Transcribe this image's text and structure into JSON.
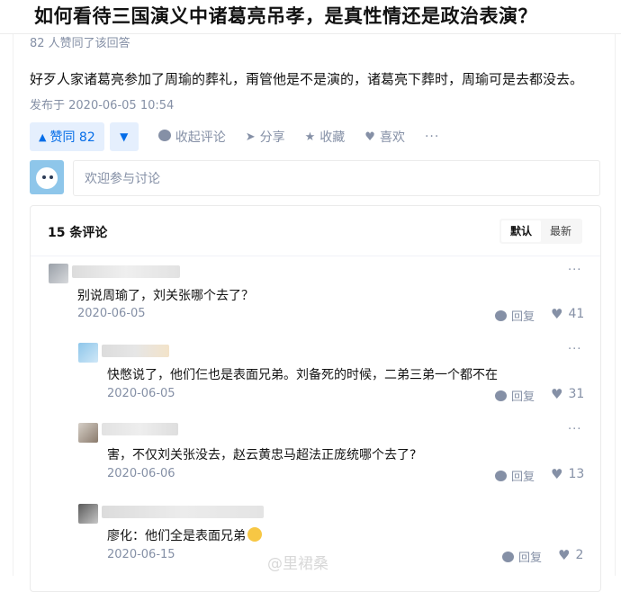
{
  "question": {
    "title": "如何看待三国演义中诸葛亮吊孝，是真性情还是政治表演？"
  },
  "answer": {
    "upvote_meta": "82 人赞同了该回答",
    "content": "好歹人家诸葛亮参加了周瑜的葬礼，甭管他是不是演的，诸葛亮下葬时，周瑜可是去都没去。",
    "published": "发布于 2020-06-05 10:54"
  },
  "actions": {
    "vote_up_label": "赞同 82",
    "vote_up_icon": "▲",
    "vote_down_icon": "▼",
    "collapse_comments": "收起评论",
    "share": "分享",
    "favorite": "收藏",
    "like": "喜欢",
    "more": "···",
    "icons": {
      "comment": "comment-icon",
      "share": "share-icon",
      "favorite": "star-icon",
      "like": "heart-icon"
    }
  },
  "comment_input": {
    "placeholder": "欢迎参与讨论"
  },
  "comments_panel": {
    "count_label": "15 条评论",
    "sort_options": [
      "默认",
      "最新"
    ],
    "active_sort": "默认",
    "comments": [
      {
        "text": "别说周瑜了，刘关张哪个去了？",
        "date": "2020-06-05",
        "reply": "回复",
        "likes": "41",
        "more": "···"
      },
      {
        "text": "快憋说了，他们仨也是表面兄弟。刘备死的时候，二弟三弟一个都不在",
        "date": "2020-06-05",
        "reply": "回复",
        "likes": "31",
        "more": "···"
      },
      {
        "text": "害，不仅刘关张没去，赵云黄忠马超法正庞统哪个去了?",
        "date": "2020-06-06",
        "reply": "回复",
        "likes": "13",
        "more": "···"
      },
      {
        "text": "廖化：他们全是表面兄弟",
        "date": "2020-06-15",
        "reply": "回复",
        "likes": "2",
        "more": "···"
      }
    ]
  },
  "watermark": {
    "text": "@里裙桑"
  },
  "colors": {
    "accent": "#056de8",
    "accent_bg": "#e5effd",
    "meta": "#8590a6",
    "text": "#121212"
  }
}
